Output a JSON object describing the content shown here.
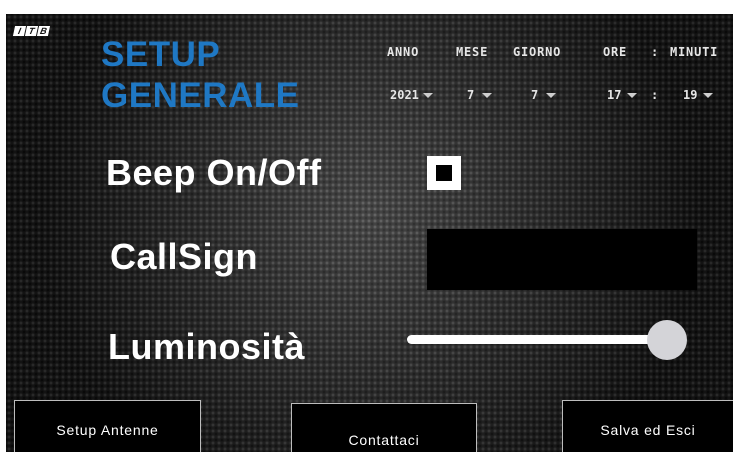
{
  "logo": {
    "letters": [
      "I",
      "T",
      "B"
    ]
  },
  "title": {
    "line1": "SETUP",
    "line2": "GENERALE"
  },
  "datetime": {
    "labels": {
      "anno": "ANNO",
      "mese": "MESE",
      "giorno": "GIORNO",
      "ore": "ORE",
      "sep": ":",
      "minuti": "MINUTI"
    },
    "values": {
      "anno": "2021",
      "mese": "7",
      "giorno": "7",
      "ore": "17",
      "sep": ":",
      "minuti": "19"
    }
  },
  "settings": {
    "beep_label": "Beep On/Off",
    "beep_checked": true,
    "callsign_label": "CallSign",
    "callsign_value": "",
    "luminosita_label": "Luminosità",
    "luminosita_level": 0.95
  },
  "buttons": {
    "setup_antenne": "Setup Antenne",
    "contattaci": "Contattaci",
    "salva_esci": "Salva ed Esci"
  }
}
